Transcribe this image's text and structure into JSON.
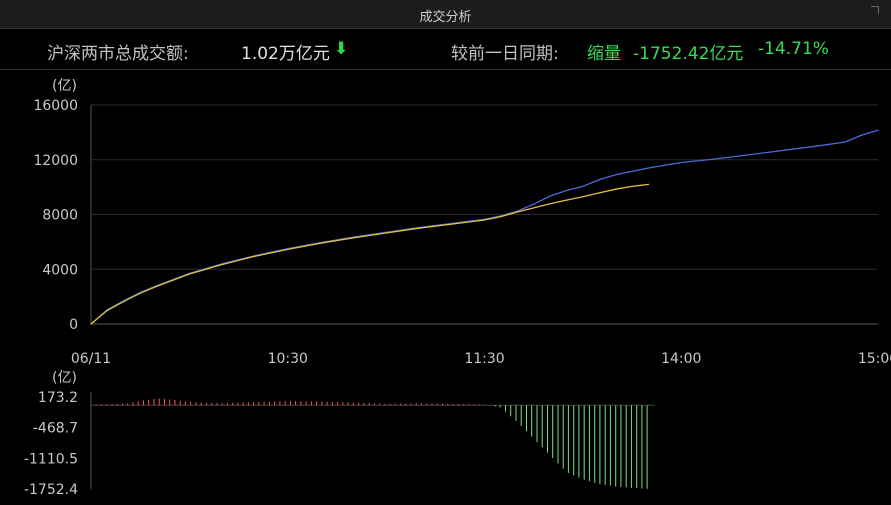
{
  "window": {
    "title": "成交分析"
  },
  "summary": {
    "total_label": "沪深两市总成交额:",
    "total_value": "1.02万亿元",
    "total_arrow": "⬇",
    "compare_label": "较前一日同期:",
    "compare_direction": "缩量",
    "compare_diff": "-1752.42亿元",
    "compare_pct": "-14.71%"
  },
  "colors": {
    "today_line": "#4a6bd8",
    "yesterday_line": "#e0c040",
    "positive_bar": "#f25a5a",
    "negative_bar": "#7de07d",
    "grid": "#2c2c2c"
  },
  "chart_data": [
    {
      "type": "line",
      "unit_label": "(亿)",
      "x_ticks": [
        "06/11",
        "10:30",
        "11:30",
        "14:00",
        "15:00"
      ],
      "y_ticks": [
        "0",
        "4000",
        "8000",
        "12000",
        "16000"
      ],
      "ylim": [
        0,
        16000
      ],
      "grid": true,
      "x_minutes": [
        0,
        5,
        10,
        15,
        20,
        30,
        40,
        50,
        60,
        70,
        80,
        90,
        100,
        110,
        120,
        125,
        130,
        135,
        140,
        145,
        150,
        155,
        160,
        165,
        170,
        180,
        190,
        200,
        210,
        220,
        230,
        235,
        240
      ],
      "series": [
        {
          "values": [
            0,
            1050,
            1700,
            2300,
            2800,
            3700,
            4400,
            5000,
            5500,
            5950,
            6350,
            6700,
            7050,
            7350,
            7650,
            7900,
            8250,
            8750,
            9350,
            9750,
            10050,
            10550,
            10900,
            11150,
            11400,
            11800,
            12050,
            12350,
            12650,
            12950,
            13300,
            13800,
            14150
          ]
        },
        {
          "values": [
            0,
            1000,
            1650,
            2250,
            2750,
            3650,
            4350,
            4950,
            5450,
            5900,
            6300,
            6650,
            7000,
            7300,
            7600,
            7850,
            8180,
            8480,
            8780,
            9050,
            9300,
            9580,
            9850,
            10050,
            10200,
            null,
            null,
            null,
            null,
            null,
            null,
            null,
            null
          ]
        }
      ]
    },
    {
      "type": "bar",
      "unit_label": "(亿)",
      "y_ticks": [
        "173.2",
        "-468.7",
        "-1110.5",
        "-1752.4"
      ],
      "ylim": [
        -1752.4,
        173.2
      ],
      "grid": false,
      "x_minutes": [
        0,
        5,
        10,
        15,
        20,
        25,
        30,
        35,
        40,
        45,
        50,
        60,
        70,
        80,
        90,
        100,
        110,
        120,
        125,
        130,
        135,
        140,
        145,
        150,
        155,
        160,
        165,
        170
      ],
      "values": [
        20,
        25,
        30,
        90,
        140,
        120,
        70,
        50,
        40,
        55,
        70,
        90,
        80,
        60,
        30,
        40,
        30,
        15,
        -50,
        -350,
        -700,
        -1050,
        -1400,
        -1550,
        -1650,
        -1700,
        -1730,
        -1752
      ]
    }
  ]
}
